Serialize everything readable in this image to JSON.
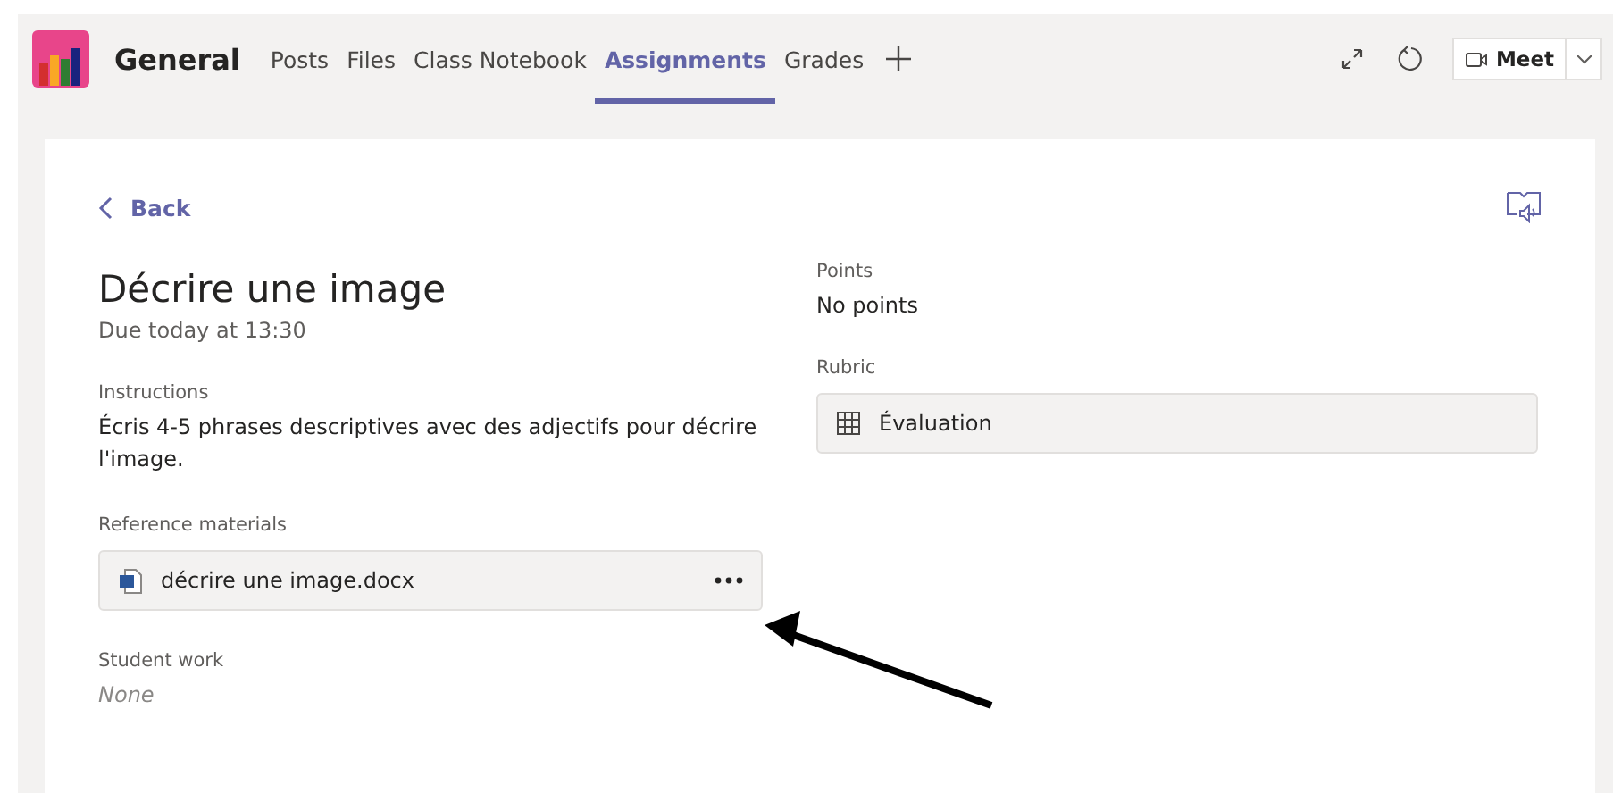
{
  "header": {
    "channel": "General",
    "tabs": [
      {
        "label": "Posts",
        "selected": false
      },
      {
        "label": "Files",
        "selected": false
      },
      {
        "label": "Class Notebook",
        "selected": false
      },
      {
        "label": "Assignments",
        "selected": true
      },
      {
        "label": "Grades",
        "selected": false
      }
    ],
    "meet_button": "Meet"
  },
  "back_link": "Back",
  "assignment": {
    "title": "Décrire une image",
    "due": "Due today at 13:30",
    "instructions_label": "Instructions",
    "instructions": "Écris 4-5 phrases descriptives avec des adjectifs pour décrire l'image.",
    "reference_label": "Reference materials",
    "reference_file": "décrire une image.docx",
    "student_work_label": "Student work",
    "student_work": "None"
  },
  "points": {
    "label": "Points",
    "value": "No points"
  },
  "rubric": {
    "label": "Rubric",
    "value": "Évaluation"
  }
}
